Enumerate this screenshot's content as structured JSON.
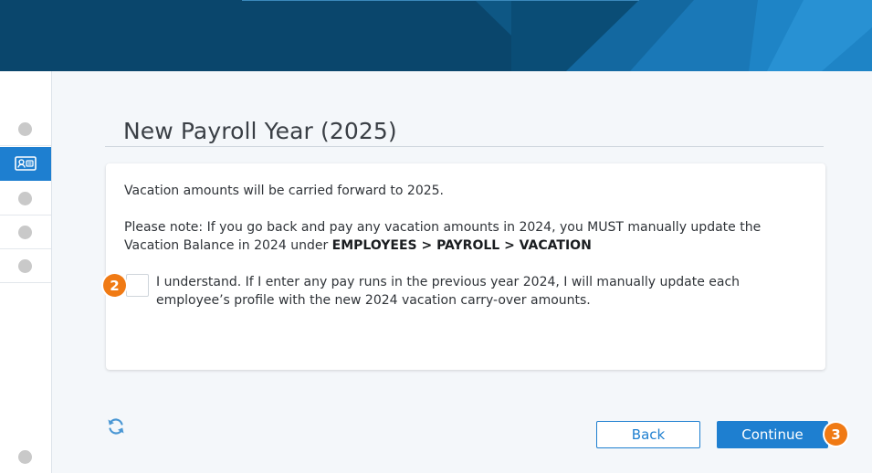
{
  "header": {
    "banner": "decorative"
  },
  "sidebar": {
    "items": [
      {
        "name": "step-1",
        "active": false
      },
      {
        "name": "payroll-year-card",
        "active": true,
        "icon": "id-card-icon"
      },
      {
        "name": "step-3",
        "active": false
      },
      {
        "name": "step-4",
        "active": false
      },
      {
        "name": "step-5",
        "active": false
      }
    ]
  },
  "page": {
    "title": "New Payroll Year (2025)"
  },
  "card": {
    "line1": "Vacation amounts will be carried forward to 2025.",
    "note_prefix": "Please note: If you go back and pay any vacation amounts in 2024, you MUST manually update the Vacation Balance in 2024 under ",
    "note_path": "EMPLOYEES > PAYROLL > VACATION",
    "ack_checked": false,
    "ack_label": "I understand. If I enter any pay runs in the previous year 2024, I will manually update each employee’s profile with the new 2024 vacation carry-over amounts."
  },
  "badges": {
    "checkbox": "2",
    "continue": "3"
  },
  "buttons": {
    "back": "Back",
    "continue": "Continue"
  },
  "colors": {
    "accent": "#1e7fd0",
    "badge": "#f07a14",
    "banner": "#0b4a72"
  }
}
